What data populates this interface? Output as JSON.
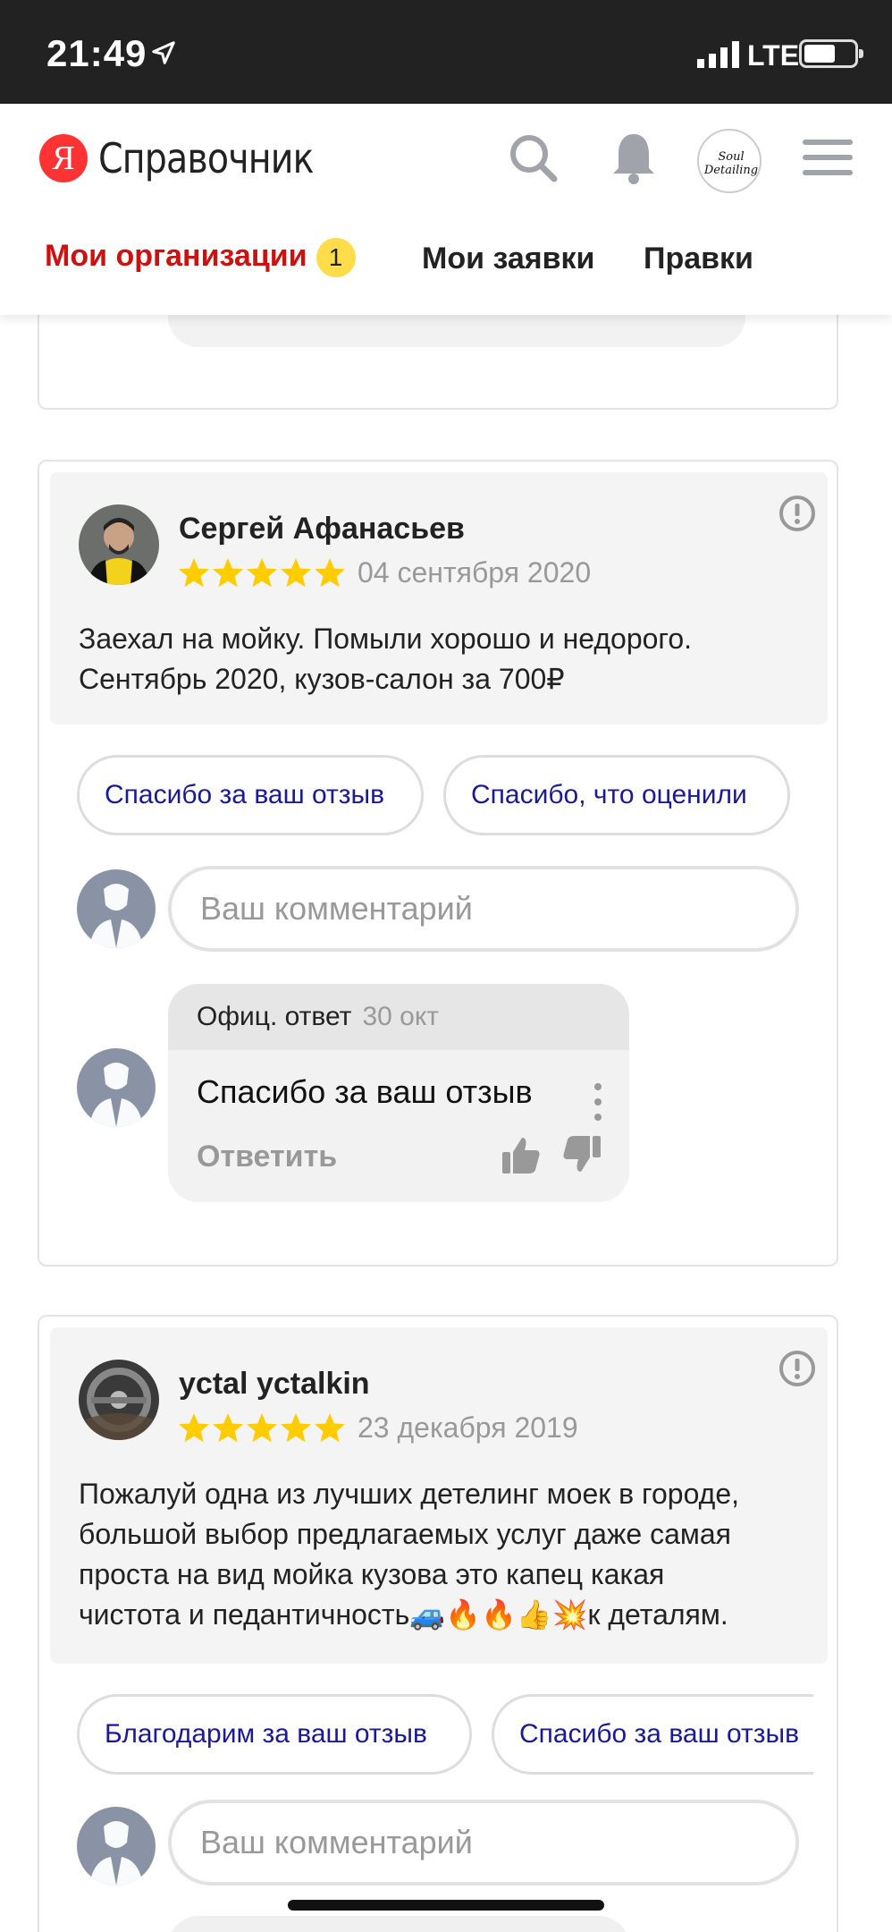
{
  "status_bar": {
    "time": "21:49",
    "network": "LTE"
  },
  "header": {
    "logo_letter": "Я",
    "logo_title": "Справочник",
    "avatar_text": "Soul Detailing",
    "tabs": [
      {
        "label": "Мои организации",
        "badge": "1"
      },
      {
        "label": "Мои заявки"
      },
      {
        "label": "Правки"
      }
    ]
  },
  "reviews": [
    {
      "author": "Сергей Афанасьев",
      "rating": 5,
      "date": "04 сентября 2020",
      "text_lines": [
        "Заехал на мойку. Помыли хорошо и недорого.",
        "Сентябрь 2020, кузов-салон за 700₽"
      ],
      "quick_replies": [
        "Спасибо за ваш отзыв",
        "Спасибо, что оценили"
      ],
      "comment_placeholder": "Ваш комментарий",
      "official_reply": {
        "label": "Офиц. ответ",
        "date": "30 окт",
        "text": "Спасибо за ваш отзыв",
        "answer_label": "Ответить"
      }
    },
    {
      "author": "yctal yctalkin",
      "rating": 5,
      "date": "23 декабря 2019",
      "text_lines": [
        "Пожалуй одна из лучших детелинг моек в городе,",
        "большой выбор предлагаемых услуг даже самая",
        "проста на вид мойка кузова это капец какая",
        "чистота и педантичность🚙🔥🔥👍💥к деталям."
      ],
      "quick_replies": [
        "Благодарим за ваш отзыв",
        "Спасибо за ваш отзыв"
      ],
      "comment_placeholder": "Ваш комментарий"
    }
  ],
  "colors": {
    "accent_red": "#cc1111",
    "chip_text": "#1a1a99",
    "star": "#ffcc00",
    "badge": "#ffdc4a"
  }
}
